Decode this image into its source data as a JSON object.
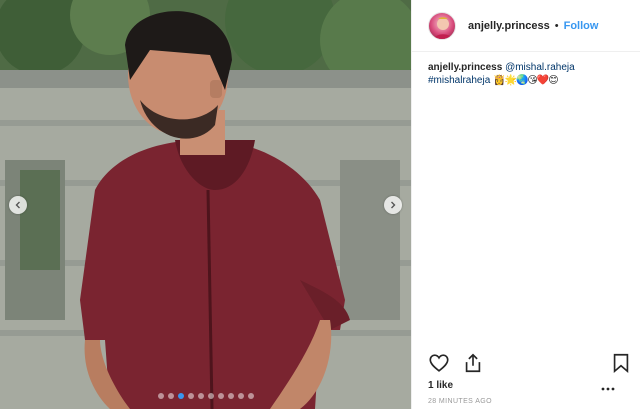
{
  "post": {
    "author": {
      "username": "anjelly.princess",
      "separator": "•",
      "follow_label": "Follow"
    },
    "caption": {
      "username": "anjelly.princess",
      "mention": "@mishal.raheja",
      "hashtag": "#mishalraheja",
      "emojis": "👸🌟🌏😘❤️😊"
    },
    "likes": "1 like",
    "timestamp": "28 MINUTES AGO",
    "carousel": {
      "slide_count": 10,
      "active_index": 2
    },
    "icons": {
      "like": "heart-icon",
      "share": "share-icon",
      "save": "bookmark-icon",
      "more": "more-options-icon",
      "prev": "chevron-left-icon",
      "next": "chevron-right-icon"
    },
    "colors": {
      "accent": "#3897f0",
      "link": "#003569",
      "text": "#262626",
      "muted": "#999999"
    }
  }
}
